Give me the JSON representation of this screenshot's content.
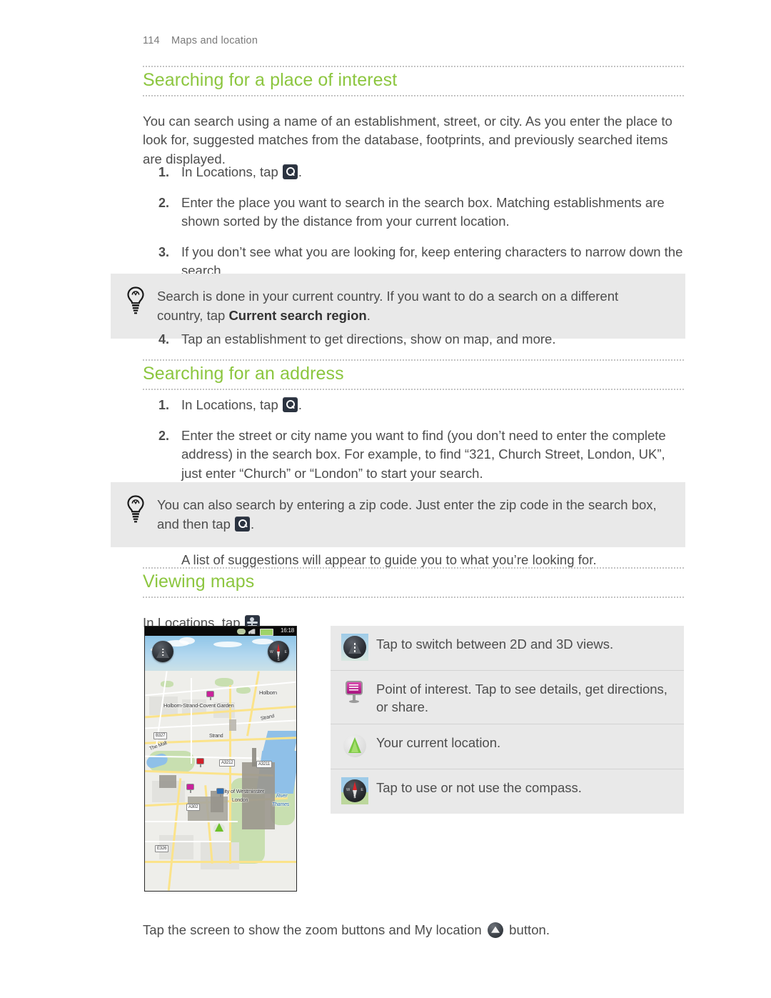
{
  "page": {
    "number": "114",
    "running_head": "Maps and location"
  },
  "sections": [
    {
      "heading": "Searching for a place of interest",
      "intro": "You can search using a name of an establishment, street, or city. As you enter the place to look for, suggested matches from the database, footprints, and previously searched items are displayed."
    },
    {
      "heading": "Searching for an address"
    },
    {
      "heading": "Viewing maps"
    }
  ],
  "list_poi": [
    {
      "num": "1.",
      "pre": "In Locations, tap ",
      "icon": "search-icon",
      "post": "."
    },
    {
      "num": "2.",
      "text": "Enter the place you want to search in the search box. Matching establishments are shown sorted by the distance from your current location."
    },
    {
      "num": "3.",
      "text": "If you don’t see what you are looking for, keep entering characters to narrow down the search."
    }
  ],
  "tip1": {
    "icon": "lightbulb-icon",
    "pre": "Search is done in your current country. If you want to do a search on a different country, tap ",
    "bold": "Current search region",
    "post": "."
  },
  "list_poi_step4": {
    "num": "4.",
    "text": "Tap an establishment to get directions, show on map, and more."
  },
  "list_address": [
    {
      "num": "1.",
      "pre": "In Locations, tap ",
      "icon": "search-icon",
      "post": "."
    },
    {
      "num": "2.",
      "text": "Enter the street or city name you want to find (you don’t need to enter the complete address) in the search box. For example, to find “321, Church Street, London, UK”, just enter “Church” or “London” to start your search."
    }
  ],
  "tip2": {
    "icon": "lightbulb-icon",
    "pre": "You can also search by entering a zip code. Just enter the zip code in the search box, and then tap ",
    "post": "."
  },
  "after_tip2": "A list of suggestions will appear to guide you to what you’re looking for.",
  "viewing_maps": {
    "pre": "In Locations, tap ",
    "icon": "map-pin-icon",
    "post": "."
  },
  "legend": {
    "rows": [
      {
        "icon": "road-3d-icon",
        "text": "Tap to switch between 2D and 3D views."
      },
      {
        "icon": "point-of-interest-pin-icon",
        "text": "Point of interest. Tap to see details, get directions, or share."
      },
      {
        "icon": "current-location-icon",
        "text": "Your current location."
      },
      {
        "icon": "compass-icon",
        "text": "Tap to use or not use the compass."
      }
    ]
  },
  "phone": {
    "status": {
      "time": "16:18"
    },
    "map_labels": [
      "Holborn",
      "Holborn-Strand-Covent Garden",
      "Strand",
      "Strand",
      "The Mall",
      "City of Westminster",
      "London",
      "River",
      "Thames"
    ],
    "road_shields": [
      "B327",
      "A3212",
      "A3211",
      "A302",
      "E326"
    ]
  },
  "caption": {
    "pre": "Tap the screen to show the zoom buttons and My location ",
    "icon": "my-location-button-icon",
    "post": " button."
  }
}
